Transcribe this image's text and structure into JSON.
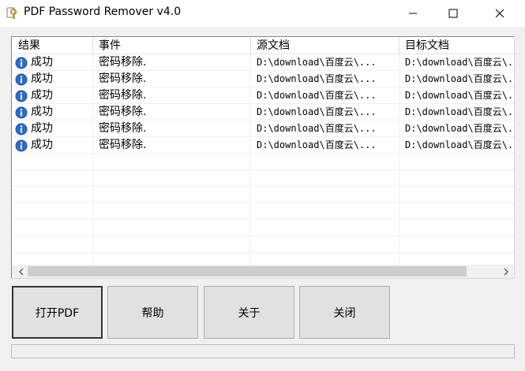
{
  "window": {
    "title": "PDF Password Remover v4.0"
  },
  "list": {
    "columns": [
      {
        "label": "结果"
      },
      {
        "label": "事件"
      },
      {
        "label": "源文档"
      },
      {
        "label": "目标文档"
      }
    ],
    "rows": [
      {
        "result": "成功",
        "event": "密码移除.",
        "source": "D:\\download\\百度云\\...",
        "target": "D:\\download\\百度云\\..."
      },
      {
        "result": "成功",
        "event": "密码移除.",
        "source": "D:\\download\\百度云\\...",
        "target": "D:\\download\\百度云\\..."
      },
      {
        "result": "成功",
        "event": "密码移除.",
        "source": "D:\\download\\百度云\\...",
        "target": "D:\\download\\百度云\\..."
      },
      {
        "result": "成功",
        "event": "密码移除.",
        "source": "D:\\download\\百度云\\...",
        "target": "D:\\download\\百度云\\..."
      },
      {
        "result": "成功",
        "event": "密码移除.",
        "source": "D:\\download\\百度云\\...",
        "target": "D:\\download\\百度云\\..."
      },
      {
        "result": "成功",
        "event": "密码移除.",
        "source": "D:\\download\\百度云\\...",
        "target": "D:\\download\\百度云\\..."
      }
    ],
    "icons": {
      "result_icon": "info-icon"
    }
  },
  "buttons": {
    "open_pdf": "打开PDF",
    "help": "帮助",
    "about": "关于",
    "close": "关闭"
  },
  "icons": {
    "app": "key-icon",
    "minimize": "minimize-icon",
    "maximize": "maximize-icon",
    "close": "close-icon",
    "scroll_left": "chevron-left-icon",
    "scroll_right": "chevron-right-icon"
  },
  "colors": {
    "info_icon": "#2b6cd4",
    "window_bg": "#f0f0f0"
  }
}
